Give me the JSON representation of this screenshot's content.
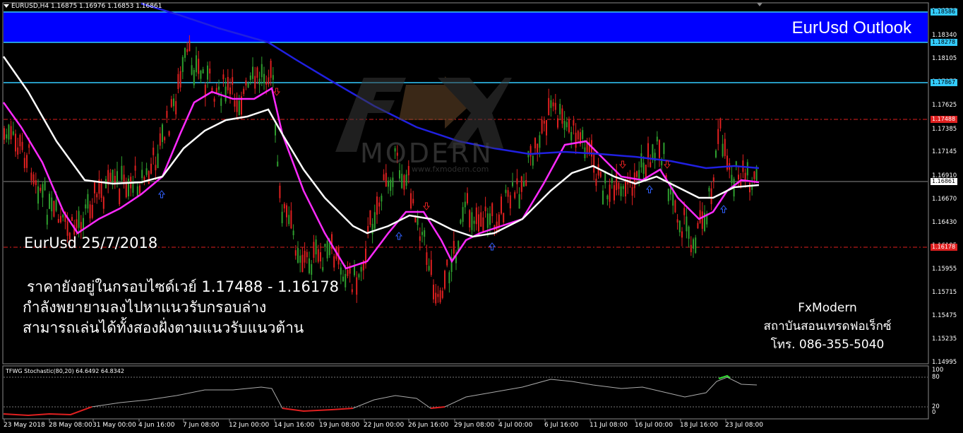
{
  "header": {
    "symbol_info": "EURUSD,H4  1.16875  1.16976  1.16853  1.16861"
  },
  "banner": {
    "title": "EurUsd Outlook"
  },
  "overlay": {
    "date": "EurUsd 25/7/2018",
    "line1": "ราคายังอยู่ในกรอบไซด์เวย์ 1.17488 - 1.16178",
    "line2": "กำลังพยายามลงไปหาแนวรับกรอบล่าง",
    "line3": "สามารถเล่นได้ทั้งสองฝั่งตามแนวรับแนวต้าน"
  },
  "brand": {
    "name": "FxModern",
    "subtitle": "สถาบันสอนเทรดฟอเร็กซ์",
    "phone": "โทร. 086-355-5040"
  },
  "watermark": {
    "text": "MODERN",
    "url": "www.fxmodern.com",
    "logo": "FX"
  },
  "price_axis": {
    "ticks": [
      "1.18586",
      "1.18340",
      "1.18105",
      "1.17875",
      "1.17625",
      "1.17385",
      "1.17145",
      "1.16910",
      "1.16670",
      "1.16430",
      "1.16195",
      "1.15955",
      "1.15715",
      "1.15475",
      "1.15235",
      "1.14995"
    ],
    "tags": [
      {
        "label": "1.18586",
        "kind": "cyan"
      },
      {
        "label": "1.18278",
        "kind": "cyan"
      },
      {
        "label": "1.17867",
        "kind": "cyan"
      },
      {
        "label": "1.17488",
        "kind": "red"
      },
      {
        "label": "1.16861",
        "kind": "price"
      },
      {
        "label": "1.16178",
        "kind": "red"
      }
    ]
  },
  "stochastic": {
    "title": "TFWG Stochastic(80,20) 64.6492 64.8342",
    "levels": [
      "100",
      "80",
      "20",
      "0"
    ]
  },
  "time_axis": [
    "23 May 2018",
    "28 May 08:00",
    "31 May 00:00",
    "4 Jun 16:00",
    "7 Jun 08:00",
    "12 Jun 00:00",
    "14 Jun 16:00",
    "19 Jun 08:00",
    "22 Jun 00:00",
    "26 Jun 16:00",
    "29 Jun 08:00",
    "4 Jul 00:00",
    "6 Jul 16:00",
    "11 Jul 08:00",
    "16 Jul 00:00",
    "18 Jul 16:00",
    "23 Jul 08:00"
  ],
  "colors": {
    "bull": "#2e9e2e",
    "bear": "#e02020",
    "ma_fast": "#ff2aff",
    "ma_slow": "#ffffff",
    "ma_long": "#2020e0",
    "level": "#33ccff",
    "band": "#0000ff"
  }
}
